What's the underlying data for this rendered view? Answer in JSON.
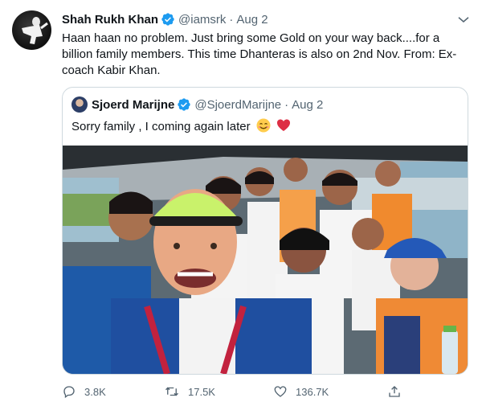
{
  "tweet": {
    "author_name": "Shah Rukh Khan",
    "author_handle": "@iamsrk",
    "separator": "·",
    "date": "Aug 2",
    "text": "Haan haan no problem. Just bring some Gold on your way back....for a billion family members. This time Dhanteras is also on 2nd Nov. From: Ex-coach Kabir Khan."
  },
  "quoted_tweet": {
    "author_name": "Sjoerd Marijne",
    "author_handle": "@SjoerdMarijne",
    "separator": "·",
    "date": "Aug 2",
    "text": "Sorry family , I coming again later"
  },
  "actions": {
    "replies": "3.8K",
    "retweets": "17.5K",
    "likes": "136.7K"
  },
  "colors": {
    "verified": "#1d9bf0",
    "text": "#0f1419",
    "secondary": "#536471",
    "border": "#cfd9de"
  },
  "icons": [
    "verified-badge-icon",
    "more-options-icon",
    "reply-icon",
    "retweet-icon",
    "like-icon",
    "share-icon",
    "smiling-face-emoji",
    "red-heart-emoji"
  ]
}
